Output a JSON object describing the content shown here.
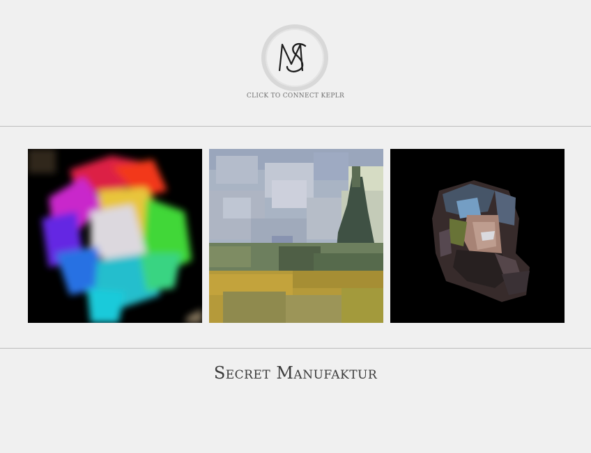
{
  "header": {
    "logo_monogram": "MS",
    "connect_label": "CLICK TO CONNECT KEPLR"
  },
  "gallery": {
    "items": [
      {
        "name": "artwork-1"
      },
      {
        "name": "artwork-2"
      },
      {
        "name": "artwork-3"
      }
    ]
  },
  "footer": {
    "brand_title": "Secret Manufaktur"
  },
  "colors": {
    "background": "#f0f0f0",
    "divider": "#bdbdbd",
    "text_primary": "#3a3a3a",
    "text_muted": "#6e6e6e",
    "logo_ring": "#d6d6d6",
    "art_background": "#000000"
  }
}
